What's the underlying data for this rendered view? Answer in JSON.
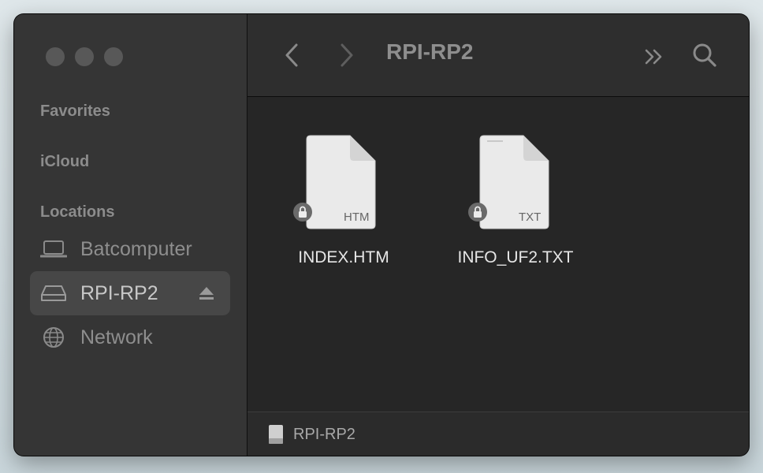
{
  "window": {
    "title": "RPI-RP2"
  },
  "sidebar": {
    "sections": {
      "favorites": "Favorites",
      "icloud": "iCloud",
      "locations": "Locations"
    },
    "items": [
      {
        "label": "Batcomputer",
        "icon": "laptop-icon"
      },
      {
        "label": "RPI-RP2",
        "icon": "external-drive-icon",
        "selected": true
      },
      {
        "label": "Network",
        "icon": "globe-icon"
      }
    ]
  },
  "files": [
    {
      "name": "INDEX.HTM",
      "ext": "HTM",
      "locked": true
    },
    {
      "name": "INFO_UF2.TXT",
      "ext": "TXT",
      "locked": true
    }
  ],
  "pathbar": {
    "label": "RPI-RP2"
  },
  "colors": {
    "window_bg": "#262626",
    "sidebar_bg": "#353535",
    "selected_bg": "#474747"
  }
}
